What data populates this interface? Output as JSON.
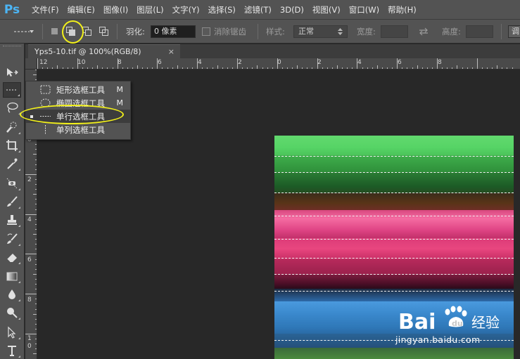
{
  "app": {
    "logo_text": "Ps"
  },
  "menubar": {
    "items": [
      "文件(F)",
      "编辑(E)",
      "图像(I)",
      "图层(L)",
      "文字(Y)",
      "选择(S)",
      "滤镜(T)",
      "3D(D)",
      "视图(V)",
      "窗口(W)",
      "帮助(H)"
    ]
  },
  "options_bar": {
    "feather_label": "羽化:",
    "feather_value": "0 像素",
    "antialias_label": "消除锯齿",
    "style_label": "样式:",
    "style_value": "正常",
    "width_label": "宽度:",
    "height_label": "高度:",
    "refine_button_label": "调"
  },
  "document": {
    "tab_title": "Yps5-10.tif @ 100%(RGB/8)",
    "close_glyph": "×"
  },
  "rulers": {
    "horizontal_ticks": [
      "12",
      "10",
      "8",
      "6",
      "4",
      "2",
      "0",
      "2",
      "4",
      "6",
      "8"
    ],
    "vertical_ticks": [
      "0",
      "2",
      "4",
      "6",
      "8",
      "1",
      "0"
    ]
  },
  "flyout": {
    "items": [
      {
        "label": "矩形选框工具",
        "shortcut": "M",
        "icon": "rect-marquee-icon",
        "active": false
      },
      {
        "label": "椭圆选框工具",
        "shortcut": "M",
        "icon": "ellipse-marquee-icon",
        "active": false
      },
      {
        "label": "单行选框工具",
        "shortcut": "",
        "icon": "single-row-marquee-icon",
        "active": true
      },
      {
        "label": "单列选框工具",
        "shortcut": "",
        "icon": "single-column-marquee-icon",
        "active": false
      }
    ]
  },
  "watermark": {
    "brand_text": "Bai",
    "brand_text_2": "du",
    "brand_cn": "经验",
    "url": "jingyan.baidu.com"
  },
  "colors": {
    "highlight": "#f2f01a",
    "green_band": "#3cc84e",
    "pink_band": "#e8347a",
    "blue_band": "#2f7fc4"
  }
}
